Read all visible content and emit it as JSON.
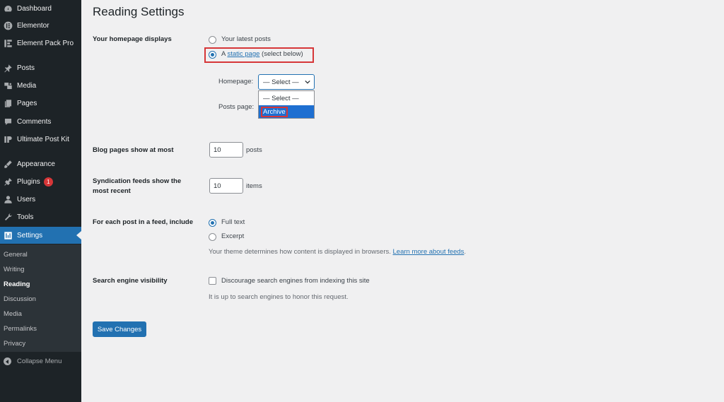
{
  "sidebar": {
    "items": [
      {
        "label": "Dashboard",
        "icon": "dashboard-icon"
      },
      {
        "label": "Elementor",
        "icon": "elementor-icon"
      },
      {
        "label": "Element Pack Pro",
        "icon": "element-pack-icon"
      },
      {
        "label": "Posts",
        "icon": "pin-icon"
      },
      {
        "label": "Media",
        "icon": "media-icon"
      },
      {
        "label": "Pages",
        "icon": "pages-icon"
      },
      {
        "label": "Comments",
        "icon": "comments-icon"
      },
      {
        "label": "Ultimate Post Kit",
        "icon": "post-kit-icon"
      },
      {
        "label": "Appearance",
        "icon": "appearance-icon"
      },
      {
        "label": "Plugins",
        "icon": "plugins-icon",
        "badge": "1"
      },
      {
        "label": "Users",
        "icon": "users-icon"
      },
      {
        "label": "Tools",
        "icon": "tools-icon"
      },
      {
        "label": "Settings",
        "icon": "settings-icon"
      }
    ],
    "submenu": [
      {
        "label": "General"
      },
      {
        "label": "Writing"
      },
      {
        "label": "Reading"
      },
      {
        "label": "Discussion"
      },
      {
        "label": "Media"
      },
      {
        "label": "Permalinks"
      },
      {
        "label": "Privacy"
      }
    ],
    "collapse_label": "Collapse Menu"
  },
  "main": {
    "title": "Reading Settings",
    "homepage_displays": {
      "label": "Your homepage displays",
      "option_latest": "Your latest posts",
      "option_static_prefix": "A",
      "option_static_link": "static page",
      "option_static_suffix": "(select below)",
      "homepage_label": "Homepage:",
      "posts_page_label": "Posts page:",
      "select_value": "— Select —",
      "dropdown_options": [
        "— Select —",
        "Archive"
      ]
    },
    "blog_pages": {
      "label": "Blog pages show at most",
      "value": "10",
      "suffix": "posts"
    },
    "syndication": {
      "label_line1": "Syndication feeds show the",
      "label_line2": "most recent",
      "value": "10",
      "suffix": "items"
    },
    "feed_include": {
      "label": "For each post in a feed, include",
      "option_full": "Full text",
      "option_excerpt": "Excerpt",
      "note_prefix": "Your theme determines how content is displayed in browsers.",
      "note_link": "Learn more about feeds",
      "note_suffix": "."
    },
    "search_visibility": {
      "label": "Search engine visibility",
      "checkbox_label": "Discourage search engines from indexing this site",
      "note": "It is up to search engines to honor this request."
    },
    "save_label": "Save Changes"
  },
  "colors": {
    "accent": "#2271b1",
    "sidebar": "#1d2327",
    "highlight": "#d63638"
  }
}
